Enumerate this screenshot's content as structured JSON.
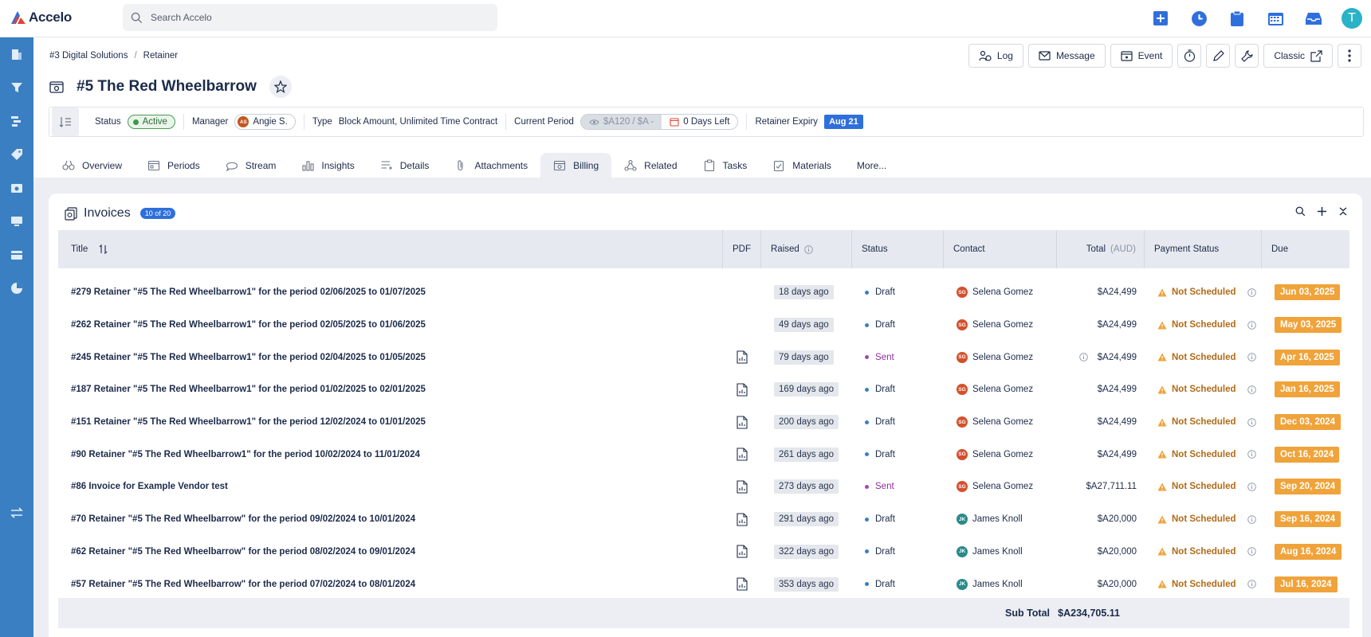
{
  "app": {
    "name": "Accelo"
  },
  "search": {
    "placeholder": "Search Accelo"
  },
  "user": {
    "initial": "T"
  },
  "colors": {
    "sidebar": "#3a7fc2",
    "accent": "#2f6fdc",
    "due": "#f0a33a",
    "active": "#3c9a48"
  },
  "breadcrumb": [
    "#3 Digital Solutions",
    "/",
    "Retainer"
  ],
  "actions": {
    "log": "Log",
    "message": "Message",
    "event": "Event",
    "classic": "Classic"
  },
  "title": "#5 The Red Wheelbarrow",
  "statusbar": {
    "status_label": "Status",
    "status_value": "Active",
    "manager_label": "Manager",
    "manager_initials": "AS",
    "manager_value": "Angie S.",
    "type_label": "Type",
    "type_value": "Block Amount, Unlimited Time Contract",
    "period_label": "Current Period",
    "period_amount": "$A120 / $A -",
    "period_days": "0 Days Left",
    "expiry_label": "Retainer Expiry",
    "expiry_value": "Aug 21"
  },
  "tabs": [
    {
      "label": "Overview",
      "icon": "binoculars-icon"
    },
    {
      "label": "Periods",
      "icon": "calendar-icon"
    },
    {
      "label": "Stream",
      "icon": "chat-icon"
    },
    {
      "label": "Insights",
      "icon": "chart-icon"
    },
    {
      "label": "Details",
      "icon": "list-icon"
    },
    {
      "label": "Attachments",
      "icon": "paperclip-icon"
    },
    {
      "label": "Billing",
      "icon": "billing-icon"
    },
    {
      "label": "Related",
      "icon": "related-icon"
    },
    {
      "label": "Tasks",
      "icon": "clipboard-icon"
    },
    {
      "label": "Materials",
      "icon": "materials-icon"
    },
    {
      "label": "More...",
      "icon": ""
    }
  ],
  "invoices": {
    "title": "Invoices",
    "count": "10 of 20",
    "columns": {
      "title": "Title",
      "pdf": "PDF",
      "raised": "Raised",
      "status": "Status",
      "contact": "Contact",
      "total": "Total",
      "total_unit": "(AUD)",
      "payment": "Payment Status",
      "due": "Due"
    },
    "rows": [
      {
        "title": "#279 Retainer \"#5 The Red Wheelbarrow1\" for the period 02/06/2025 to 01/07/2025",
        "pdf": false,
        "raised": "18 days ago",
        "status": "Draft",
        "contact_initials": "SG",
        "contact": "Selena Gomez",
        "total_info": false,
        "total": "$A24,499",
        "payment": "Not Scheduled",
        "due": "Jun 03, 2025"
      },
      {
        "title": "#262 Retainer \"#5 The Red Wheelbarrow1\" for the period 02/05/2025 to 01/06/2025",
        "pdf": false,
        "raised": "49 days ago",
        "status": "Draft",
        "contact_initials": "SG",
        "contact": "Selena Gomez",
        "total_info": false,
        "total": "$A24,499",
        "payment": "Not Scheduled",
        "due": "May 03, 2025"
      },
      {
        "title": "#245 Retainer \"#5 The Red Wheelbarrow1\" for the period 02/04/2025 to 01/05/2025",
        "pdf": true,
        "raised": "79 days ago",
        "status": "Sent",
        "contact_initials": "SG",
        "contact": "Selena Gomez",
        "total_info": true,
        "total": "$A24,499",
        "payment": "Not Scheduled",
        "due": "Apr 16, 2025"
      },
      {
        "title": "#187 Retainer \"#5 The Red Wheelbarrow1\" for the period 01/02/2025 to 02/01/2025",
        "pdf": true,
        "raised": "169 days ago",
        "status": "Draft",
        "contact_initials": "SG",
        "contact": "Selena Gomez",
        "total_info": false,
        "total": "$A24,499",
        "payment": "Not Scheduled",
        "due": "Jan 16, 2025"
      },
      {
        "title": "#151 Retainer \"#5 The Red Wheelbarrow1\" for the period 12/02/2024 to 01/01/2025",
        "pdf": true,
        "raised": "200 days ago",
        "status": "Draft",
        "contact_initials": "SG",
        "contact": "Selena Gomez",
        "total_info": false,
        "total": "$A24,499",
        "payment": "Not Scheduled",
        "due": "Dec 03, 2024"
      },
      {
        "title": "#90 Retainer \"#5 The Red Wheelbarrow1\" for the period 10/02/2024 to 11/01/2024",
        "pdf": true,
        "raised": "261 days ago",
        "status": "Draft",
        "contact_initials": "SG",
        "contact": "Selena Gomez",
        "total_info": false,
        "total": "$A24,499",
        "payment": "Not Scheduled",
        "due": "Oct 16, 2024"
      },
      {
        "title": "#86 Invoice for Example Vendor test",
        "pdf": true,
        "raised": "273 days ago",
        "status": "Sent",
        "contact_initials": "SG",
        "contact": "Selena Gomez",
        "total_info": false,
        "total": "$A27,711.11",
        "payment": "Not Scheduled",
        "due": "Sep 20, 2024"
      },
      {
        "title": "#70 Retainer \"#5 The Red Wheelbarrow\" for the period 09/02/2024 to 10/01/2024",
        "pdf": true,
        "raised": "291 days ago",
        "status": "Draft",
        "contact_initials": "JK",
        "contact": "James Knoll",
        "total_info": false,
        "total": "$A20,000",
        "payment": "Not Scheduled",
        "due": "Sep 16, 2024"
      },
      {
        "title": "#62 Retainer \"#5 The Red Wheelbarrow\" for the period 08/02/2024 to 09/01/2024",
        "pdf": true,
        "raised": "322 days ago",
        "status": "Draft",
        "contact_initials": "JK",
        "contact": "James Knoll",
        "total_info": false,
        "total": "$A20,000",
        "payment": "Not Scheduled",
        "due": "Aug 16, 2024"
      },
      {
        "title": "#57 Retainer \"#5 The Red Wheelbarrow\" for the period 07/02/2024 to 08/01/2024",
        "pdf": true,
        "raised": "353 days ago",
        "status": "Draft",
        "contact_initials": "JK",
        "contact": "James Knoll",
        "total_info": false,
        "total": "$A20,000",
        "payment": "Not Scheduled",
        "due": "Jul 16, 2024"
      }
    ],
    "subtotal_label": "Sub Total",
    "subtotal_value": "$A234,705.11"
  }
}
